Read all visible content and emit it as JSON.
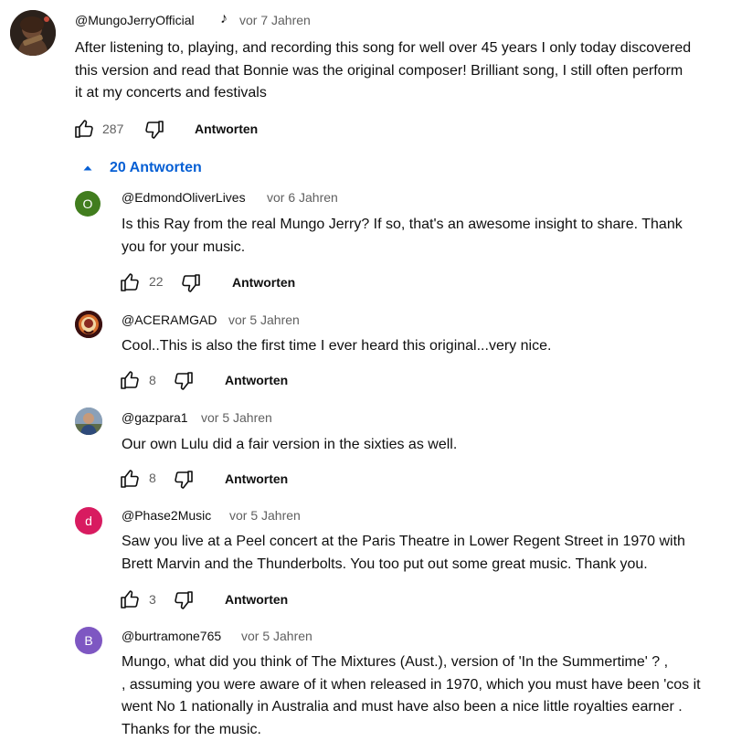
{
  "top_comment": {
    "handle": "@MungoJerryOfficial",
    "music_note": "♪",
    "time": "vor 7 Jahren",
    "lines": [
      "After listening to, playing, and recording this song for well over 45 years I only today discovered",
      "this version and read that Bonnie was the original composer!  Brilliant song, I still often perform",
      "it at my concerts and festivals"
    ],
    "likes": "287",
    "reply_label": "Antworten"
  },
  "replies_toggle": {
    "icon": "caret-up-icon",
    "label": "20 Antworten"
  },
  "replies": [
    {
      "avatar_letter": "O",
      "avatar_color": "#417d1e",
      "handle": "@EdmondOliverLives",
      "time": "vor 6 Jahren",
      "lines": [
        "Is this Ray from the real Mungo Jerry? If so, that's an awesome insight to share. Thank",
        "you for your music."
      ],
      "likes": "22",
      "reply_label": "Antworten"
    },
    {
      "avatar_letter": "",
      "avatar_color": "#4a1a1a",
      "handle": "@ACERAMGAD",
      "time": "vor 5 Jahren",
      "lines": [
        "Cool..This is also the first time I ever heard this original...very nice."
      ],
      "likes": "8",
      "reply_label": "Antworten"
    },
    {
      "avatar_letter": "",
      "avatar_color": "#7d8fa5",
      "handle": "@gazpara1",
      "time": "vor 5 Jahren",
      "lines": [
        "Our own Lulu did a fair version in the sixties as well."
      ],
      "likes": "8",
      "reply_label": "Antworten"
    },
    {
      "avatar_letter": "d",
      "avatar_color": "#d81b60",
      "handle": "@Phase2Music",
      "time": "vor 5 Jahren",
      "lines": [
        "Saw you live at a Peel concert at the Paris Theatre in Lower Regent Street in 1970 with",
        "Brett Marvin and the Thunderbolts. You too put out some great music. Thank you."
      ],
      "likes": "3",
      "reply_label": "Antworten"
    },
    {
      "avatar_letter": "B",
      "avatar_color": "#7e57c2",
      "handle": "@burtramone765",
      "time": "vor 5 Jahren",
      "lines": [
        "Mungo,  what did you think of The Mixtures (Aust.), version of  'In the Summertime' ? ,",
        ", assuming you were aware of it when released in 1970, which you must have been 'cos it",
        "went No 1 nationally in Australia and must have also  been a nice little royalties earner .",
        "Thanks for the music."
      ]
    }
  ]
}
